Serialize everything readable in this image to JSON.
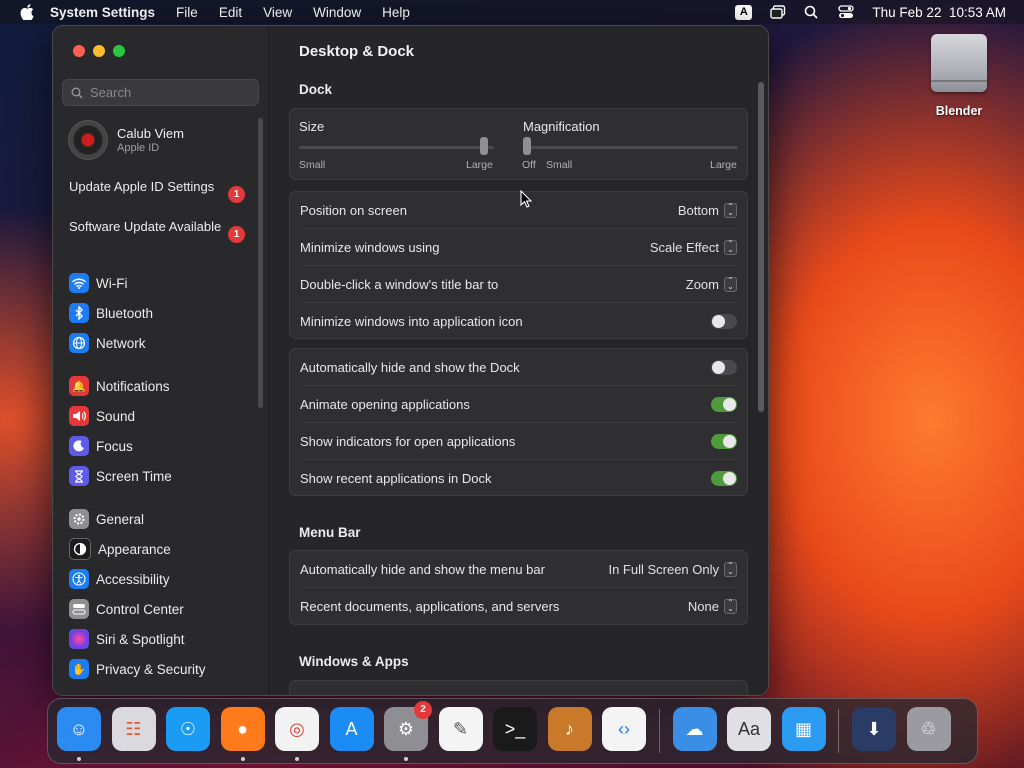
{
  "menubar": {
    "app_name": "System Settings",
    "menus": [
      "File",
      "Edit",
      "View",
      "Window",
      "Help"
    ],
    "input_badge": "A",
    "datetime": "Thu Feb 22  10:53 AM"
  },
  "desktop": {
    "drive_label": "Blender"
  },
  "sidebar": {
    "search_placeholder": "Search",
    "account": {
      "name": "Calub Viem",
      "subtitle": "Apple ID"
    },
    "notices": [
      {
        "label": "Update Apple ID Settings",
        "badge": "1"
      },
      {
        "label": "Software Update Available",
        "badge": "1"
      }
    ],
    "items": [
      {
        "label": "Wi-Fi",
        "icon": "wifi-icon",
        "color": "#1e7cf2"
      },
      {
        "label": "Bluetooth",
        "icon": "bluetooth-icon",
        "color": "#1e7cf2"
      },
      {
        "label": "Network",
        "icon": "globe-icon",
        "color": "#1e7cf2"
      },
      {
        "label": "Notifications",
        "icon": "bell-icon",
        "color": "#e5383b"
      },
      {
        "label": "Sound",
        "icon": "speaker-icon",
        "color": "#e5383b"
      },
      {
        "label": "Focus",
        "icon": "moon-icon",
        "color": "#5e5ce6"
      },
      {
        "label": "Screen Time",
        "icon": "hourglass-icon",
        "color": "#5e5ce6"
      },
      {
        "label": "General",
        "icon": "gear-icon",
        "color": "#8e8e93"
      },
      {
        "label": "Appearance",
        "icon": "appearance-icon",
        "color": "#1c1c1e"
      },
      {
        "label": "Accessibility",
        "icon": "accessibility-icon",
        "color": "#1e7cf2"
      },
      {
        "label": "Control Center",
        "icon": "control-center-icon",
        "color": "#8e8e93"
      },
      {
        "label": "Siri & Spotlight",
        "icon": "siri-icon",
        "color": "#b03ad0"
      },
      {
        "label": "Privacy & Security",
        "icon": "hand-icon",
        "color": "#1e7cf2"
      }
    ]
  },
  "main": {
    "title": "Desktop & Dock",
    "dock_section": "Dock",
    "size": {
      "label": "Size",
      "min": "Small",
      "max": "Large",
      "value": 0.95
    },
    "magnification": {
      "label": "Magnification",
      "off": "Off",
      "min": "Small",
      "max": "Large",
      "value": 0.0
    },
    "popups": [
      {
        "label": "Position on screen",
        "value": "Bottom"
      },
      {
        "label": "Minimize windows using",
        "value": "Scale Effect"
      },
      {
        "label": "Double-click a window's title bar to",
        "value": "Zoom"
      }
    ],
    "minimize_into_icon": {
      "label": "Minimize windows into application icon",
      "on": false
    },
    "toggles": [
      {
        "label": "Automatically hide and show the Dock",
        "on": false
      },
      {
        "label": "Animate opening applications",
        "on": true
      },
      {
        "label": "Show indicators for open applications",
        "on": true
      },
      {
        "label": "Show recent applications in Dock",
        "on": true
      }
    ],
    "menubar_section": "Menu Bar",
    "menubar_rows": [
      {
        "label": "Automatically hide and show the menu bar",
        "value": "In Full Screen Only"
      },
      {
        "label": "Recent documents, applications, and servers",
        "value": "None"
      }
    ],
    "windows_section": "Windows & Apps"
  },
  "dock": {
    "apps": [
      {
        "name": "finder-icon",
        "color": "#2b8bf0",
        "running": true
      },
      {
        "name": "launchpad-icon",
        "color": "#d9d9de",
        "running": false
      },
      {
        "name": "safari-icon",
        "color": "#1a9cf5",
        "running": false
      },
      {
        "name": "firefox-icon",
        "color": "#ff7a1a",
        "running": true
      },
      {
        "name": "chrome-icon",
        "color": "#f2f2f2",
        "running": true
      },
      {
        "name": "app-store-icon",
        "color": "#1c8cf5",
        "running": false
      },
      {
        "name": "system-settings-icon",
        "color": "#8e8e93",
        "running": true,
        "badge": "2"
      },
      {
        "name": "textedit-icon",
        "color": "#f4f4f4",
        "running": false
      },
      {
        "name": "terminal-icon",
        "color": "#1a1a1a",
        "running": false
      },
      {
        "name": "garageband-icon",
        "color": "#c87a2a",
        "running": false
      },
      {
        "name": "vscode-icon",
        "color": "#f4f4f4",
        "running": false
      },
      {
        "name": "weather-icon",
        "color": "#3a8ee6",
        "running": false
      },
      {
        "name": "dictionary-icon",
        "color": "#e0e0e4",
        "running": false
      },
      {
        "name": "keynote-icon",
        "color": "#2a9bf0",
        "running": false
      },
      {
        "name": "downloads-stack-icon",
        "color": "#2a3c66",
        "running": false
      },
      {
        "name": "trash-icon",
        "color": "#9a9aa0",
        "running": false
      }
    ]
  }
}
